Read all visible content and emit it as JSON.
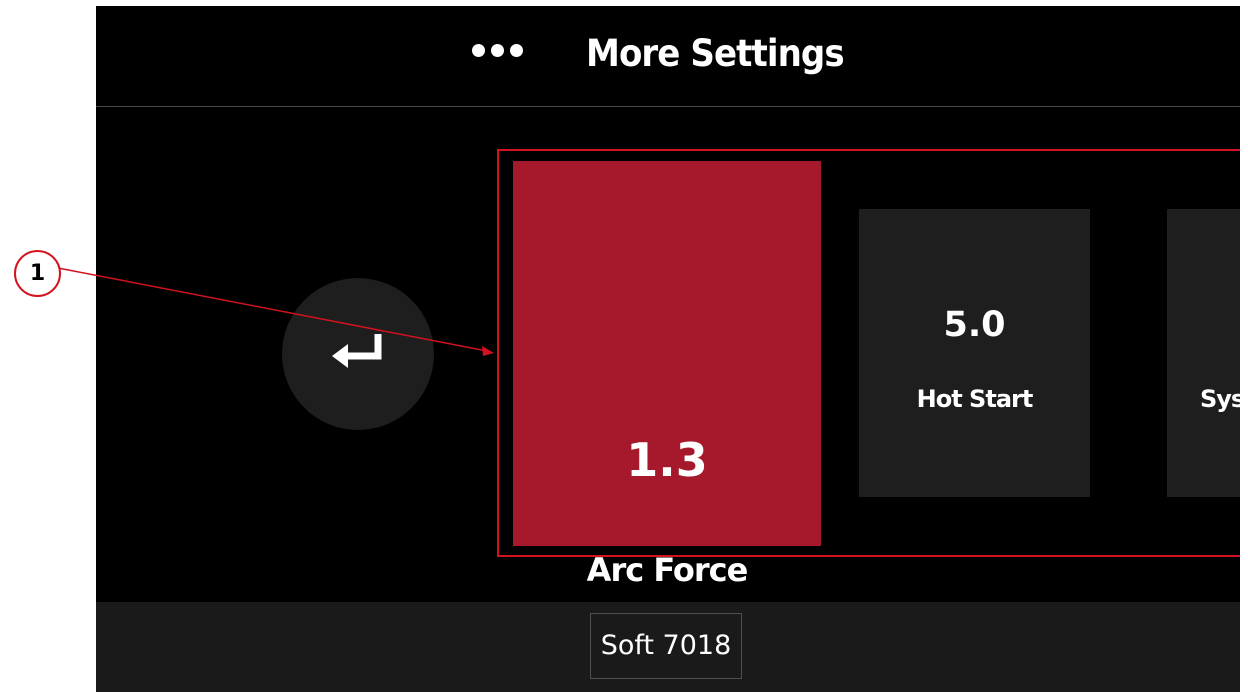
{
  "header": {
    "title": "More Settings",
    "menu_icon": "ellipsis-icon"
  },
  "back_button": {
    "icon": "return-arrow-icon"
  },
  "tiles": [
    {
      "value": "1.3",
      "label": "Arc Force",
      "state": "selected"
    },
    {
      "value": "5.0",
      "label": "Hot Start",
      "state": "normal"
    },
    {
      "value": "",
      "label": "Sys",
      "state": "partially-visible"
    }
  ],
  "footer": {
    "profile": "Soft 7018"
  },
  "callout": {
    "number": "1"
  },
  "colors": {
    "background": "#000000",
    "accent": "#a6182c",
    "tile": "#1e1e1e",
    "annotation": "#d2121f"
  }
}
